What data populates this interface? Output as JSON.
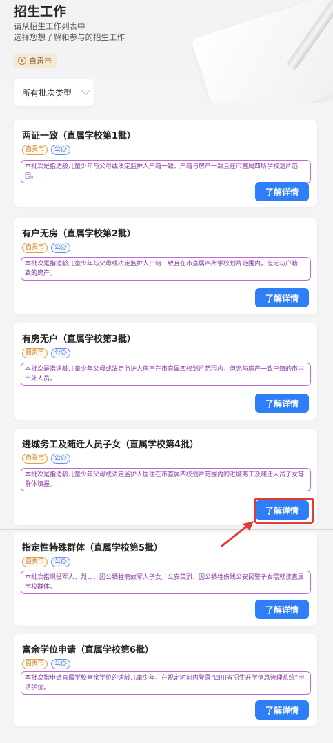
{
  "header": {
    "title": "招生工作",
    "subtitle_lines": [
      "请从招生工作列表中",
      "选择您想了解和参与的招生工作"
    ],
    "location": "自贡市"
  },
  "filter": {
    "batch_type": "所有批次类型"
  },
  "cards": [
    {
      "title": "两证一致（直属学校第1批）",
      "region_tag": "自贡市",
      "type_tag": "公办",
      "description": "本批次是指适龄儿童少年与父母或法定监护人户籍一致、户籍与房产一致且在市直属四所学校划片范围。",
      "button": "了解详情"
    },
    {
      "title": "有户无房（直属学校第2批）",
      "region_tag": "自贡市",
      "type_tag": "公办",
      "description": "本批次是指适龄儿童少年与父母或法定监护人户籍一致且在市直属四所学校划片范围内，但无与户籍一致的房产。",
      "button": "了解详情"
    },
    {
      "title": "有房无户（直属学校第3批）",
      "region_tag": "自贡市",
      "type_tag": "公办",
      "description": "本批次是指适龄儿童少年父母或法定监护人房产在市直属四校划片范围内，但无与房产一致户籍的市内市外人员。",
      "button": "了解详情"
    },
    {
      "title": "进城务工及随迁人员子女（直属学校第4批）",
      "region_tag": "自贡市",
      "type_tag": "公办",
      "description": "本批次是指适龄儿童少年父母或法定监护人居住在市直属四校划片范围内的进城务工及随迁人员子女等群体填报。",
      "button": "了解详情"
    },
    {
      "title": "指定性特殊群体（直属学校第5批）",
      "region_tag": "自贡市",
      "type_tag": "公办",
      "description": "本批次指现役军人、烈士、因公牺牲病故军人子女，公安英烈、因公牺牲伤残公安民警子女需就读直属学校群体。",
      "button": "了解详情"
    },
    {
      "title": "富余学位申请（直属学校第6批）",
      "region_tag": "自贡市",
      "type_tag": "公办",
      "description": "本批次指申请直属学校富余学位的适龄儿童少年，在规定时间内登录“四川省招生升学信息管理系统”申请学位。",
      "button": "了解详情"
    }
  ],
  "colors": {
    "primary_button": "#2d7ef7",
    "highlight": "#e23a3a",
    "region_tag": "#e0a040",
    "type_tag": "#6a8fe0",
    "desc_border": "#c06ad6"
  }
}
